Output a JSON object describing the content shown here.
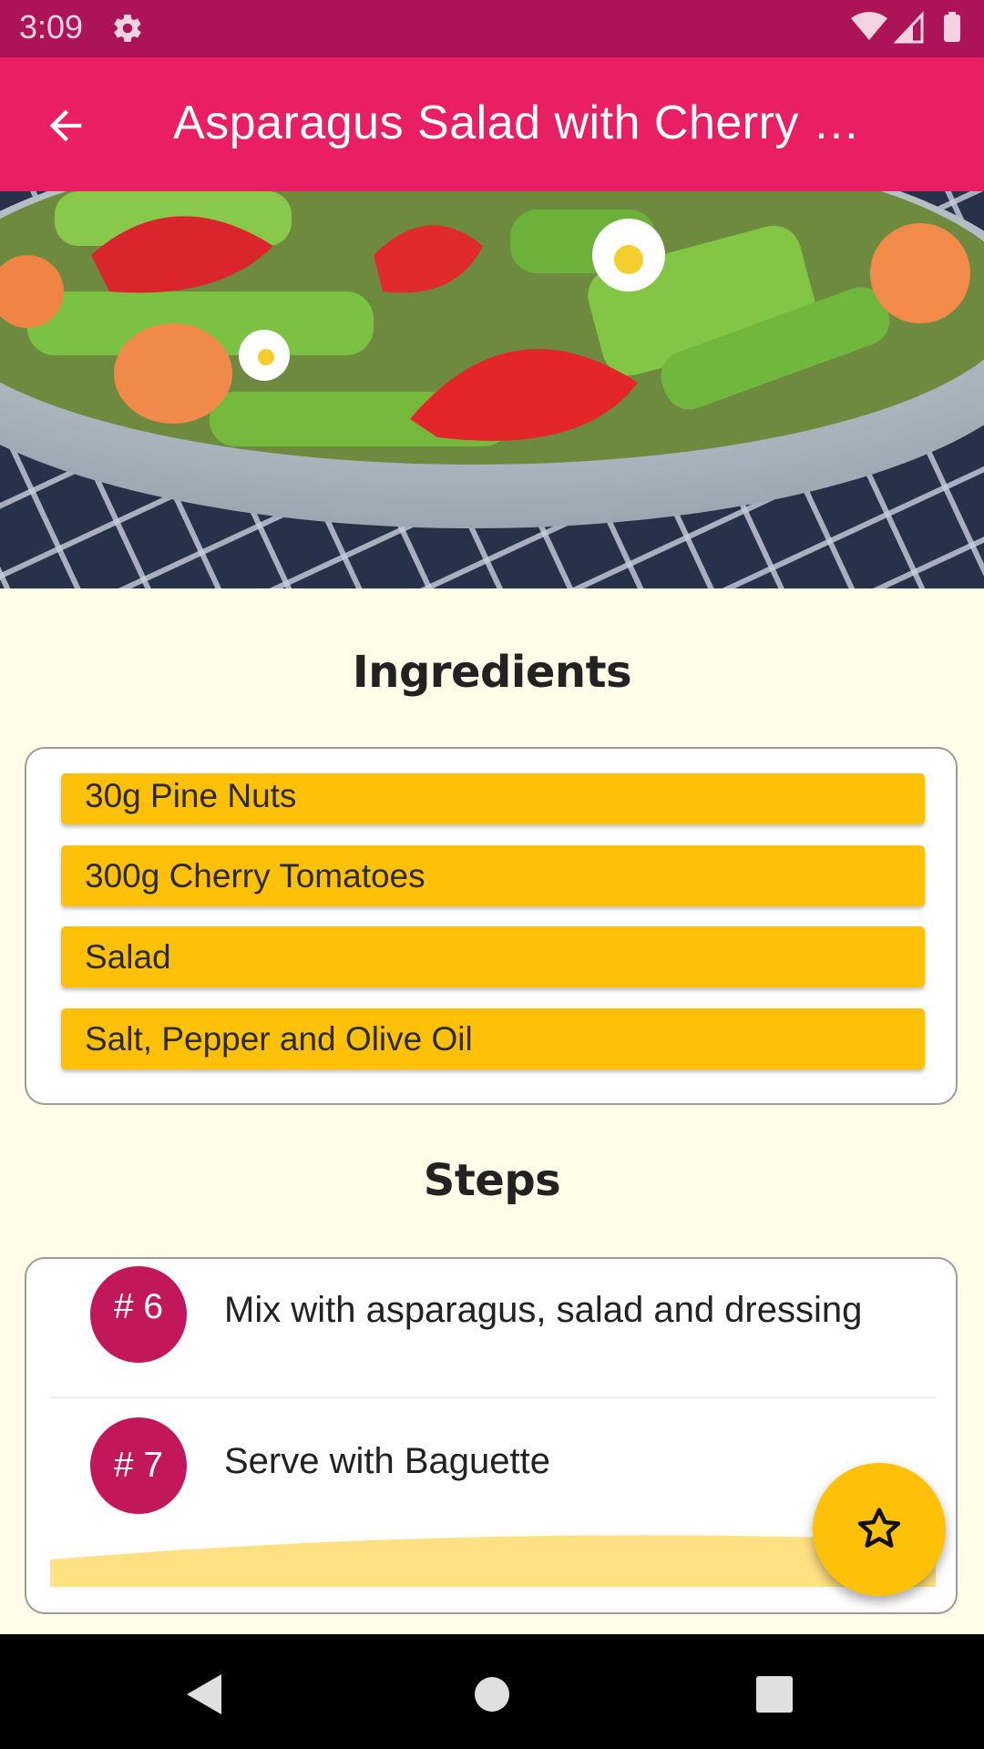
{
  "status_bar": {
    "time": "3:09",
    "icons": [
      "gear-icon",
      "wifi-icon",
      "signal-icon",
      "battery-icon"
    ]
  },
  "app_bar": {
    "title": "Asparagus Salad with Cherry …",
    "back_icon": "arrow-back-icon"
  },
  "hero": {
    "image": "salad-photo"
  },
  "ingredients": {
    "heading": "Ingredients",
    "items": [
      "30g Pine Nuts",
      "300g Cherry Tomatoes",
      "Salad",
      "Salt, Pepper and Olive Oil"
    ]
  },
  "steps": {
    "heading": "Steps",
    "items": [
      {
        "number": "# 6",
        "text": "Mix with asparagus, salad and dressing"
      },
      {
        "number": "# 7",
        "text": "Serve with Baguette"
      }
    ]
  },
  "fab": {
    "icon": "star-outline-icon"
  },
  "nav": {
    "icons": [
      "back-triangle-icon",
      "home-circle-icon",
      "recents-square-icon"
    ]
  },
  "colors": {
    "status_bar": "#ad1457",
    "app_bar": "#e91e63",
    "accent": "#ffc107",
    "step_badge": "#c2185b",
    "background": "#fffde7"
  }
}
